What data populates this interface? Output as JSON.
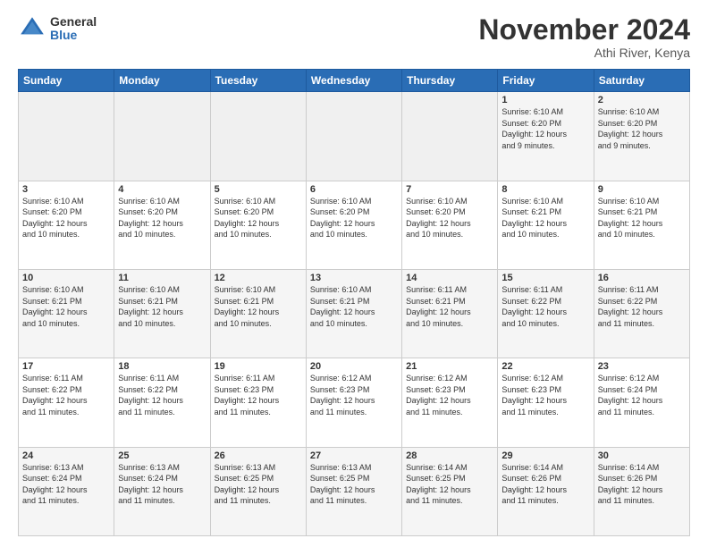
{
  "logo": {
    "general": "General",
    "blue": "Blue"
  },
  "header": {
    "month": "November 2024",
    "location": "Athi River, Kenya"
  },
  "days_of_week": [
    "Sunday",
    "Monday",
    "Tuesday",
    "Wednesday",
    "Thursday",
    "Friday",
    "Saturday"
  ],
  "weeks": [
    [
      {
        "day": "",
        "info": ""
      },
      {
        "day": "",
        "info": ""
      },
      {
        "day": "",
        "info": ""
      },
      {
        "day": "",
        "info": ""
      },
      {
        "day": "",
        "info": ""
      },
      {
        "day": "1",
        "info": "Sunrise: 6:10 AM\nSunset: 6:20 PM\nDaylight: 12 hours\nand 9 minutes."
      },
      {
        "day": "2",
        "info": "Sunrise: 6:10 AM\nSunset: 6:20 PM\nDaylight: 12 hours\nand 9 minutes."
      }
    ],
    [
      {
        "day": "3",
        "info": "Sunrise: 6:10 AM\nSunset: 6:20 PM\nDaylight: 12 hours\nand 10 minutes."
      },
      {
        "day": "4",
        "info": "Sunrise: 6:10 AM\nSunset: 6:20 PM\nDaylight: 12 hours\nand 10 minutes."
      },
      {
        "day": "5",
        "info": "Sunrise: 6:10 AM\nSunset: 6:20 PM\nDaylight: 12 hours\nand 10 minutes."
      },
      {
        "day": "6",
        "info": "Sunrise: 6:10 AM\nSunset: 6:20 PM\nDaylight: 12 hours\nand 10 minutes."
      },
      {
        "day": "7",
        "info": "Sunrise: 6:10 AM\nSunset: 6:20 PM\nDaylight: 12 hours\nand 10 minutes."
      },
      {
        "day": "8",
        "info": "Sunrise: 6:10 AM\nSunset: 6:21 PM\nDaylight: 12 hours\nand 10 minutes."
      },
      {
        "day": "9",
        "info": "Sunrise: 6:10 AM\nSunset: 6:21 PM\nDaylight: 12 hours\nand 10 minutes."
      }
    ],
    [
      {
        "day": "10",
        "info": "Sunrise: 6:10 AM\nSunset: 6:21 PM\nDaylight: 12 hours\nand 10 minutes."
      },
      {
        "day": "11",
        "info": "Sunrise: 6:10 AM\nSunset: 6:21 PM\nDaylight: 12 hours\nand 10 minutes."
      },
      {
        "day": "12",
        "info": "Sunrise: 6:10 AM\nSunset: 6:21 PM\nDaylight: 12 hours\nand 10 minutes."
      },
      {
        "day": "13",
        "info": "Sunrise: 6:10 AM\nSunset: 6:21 PM\nDaylight: 12 hours\nand 10 minutes."
      },
      {
        "day": "14",
        "info": "Sunrise: 6:11 AM\nSunset: 6:21 PM\nDaylight: 12 hours\nand 10 minutes."
      },
      {
        "day": "15",
        "info": "Sunrise: 6:11 AM\nSunset: 6:22 PM\nDaylight: 12 hours\nand 10 minutes."
      },
      {
        "day": "16",
        "info": "Sunrise: 6:11 AM\nSunset: 6:22 PM\nDaylight: 12 hours\nand 11 minutes."
      }
    ],
    [
      {
        "day": "17",
        "info": "Sunrise: 6:11 AM\nSunset: 6:22 PM\nDaylight: 12 hours\nand 11 minutes."
      },
      {
        "day": "18",
        "info": "Sunrise: 6:11 AM\nSunset: 6:22 PM\nDaylight: 12 hours\nand 11 minutes."
      },
      {
        "day": "19",
        "info": "Sunrise: 6:11 AM\nSunset: 6:23 PM\nDaylight: 12 hours\nand 11 minutes."
      },
      {
        "day": "20",
        "info": "Sunrise: 6:12 AM\nSunset: 6:23 PM\nDaylight: 12 hours\nand 11 minutes."
      },
      {
        "day": "21",
        "info": "Sunrise: 6:12 AM\nSunset: 6:23 PM\nDaylight: 12 hours\nand 11 minutes."
      },
      {
        "day": "22",
        "info": "Sunrise: 6:12 AM\nSunset: 6:23 PM\nDaylight: 12 hours\nand 11 minutes."
      },
      {
        "day": "23",
        "info": "Sunrise: 6:12 AM\nSunset: 6:24 PM\nDaylight: 12 hours\nand 11 minutes."
      }
    ],
    [
      {
        "day": "24",
        "info": "Sunrise: 6:13 AM\nSunset: 6:24 PM\nDaylight: 12 hours\nand 11 minutes."
      },
      {
        "day": "25",
        "info": "Sunrise: 6:13 AM\nSunset: 6:24 PM\nDaylight: 12 hours\nand 11 minutes."
      },
      {
        "day": "26",
        "info": "Sunrise: 6:13 AM\nSunset: 6:25 PM\nDaylight: 12 hours\nand 11 minutes."
      },
      {
        "day": "27",
        "info": "Sunrise: 6:13 AM\nSunset: 6:25 PM\nDaylight: 12 hours\nand 11 minutes."
      },
      {
        "day": "28",
        "info": "Sunrise: 6:14 AM\nSunset: 6:25 PM\nDaylight: 12 hours\nand 11 minutes."
      },
      {
        "day": "29",
        "info": "Sunrise: 6:14 AM\nSunset: 6:26 PM\nDaylight: 12 hours\nand 11 minutes."
      },
      {
        "day": "30",
        "info": "Sunrise: 6:14 AM\nSunset: 6:26 PM\nDaylight: 12 hours\nand 11 minutes."
      }
    ]
  ]
}
